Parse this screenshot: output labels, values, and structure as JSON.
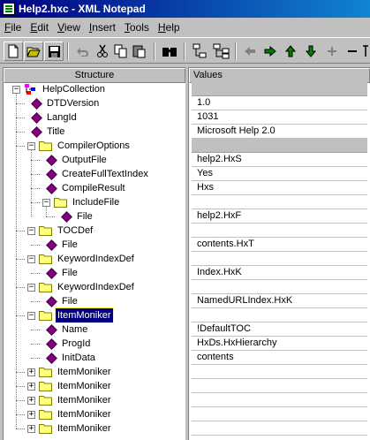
{
  "window": {
    "title": "Help2.hxc - XML Notepad"
  },
  "menu": [
    {
      "label": "File",
      "u": "F",
      "rest": "ile"
    },
    {
      "label": "Edit",
      "u": "E",
      "rest": "dit"
    },
    {
      "label": "View",
      "u": "V",
      "rest": "iew"
    },
    {
      "label": "Insert",
      "u": "I",
      "rest": "nsert"
    },
    {
      "label": "Tools",
      "u": "T",
      "rest": "ools"
    },
    {
      "label": "Help",
      "u": "H",
      "rest": "elp"
    }
  ],
  "columns": {
    "structure": "Structure",
    "values": "Values"
  },
  "tree": [
    {
      "label": "HelpCollection",
      "kind": "root",
      "depth": 0,
      "expanded": true,
      "value": null
    },
    {
      "label": "DTDVersion",
      "kind": "attr",
      "depth": 1,
      "value": "1.0"
    },
    {
      "label": "LangId",
      "kind": "attr",
      "depth": 1,
      "value": "1031"
    },
    {
      "label": "Title",
      "kind": "attr",
      "depth": 1,
      "value": "Microsoft Help 2.0"
    },
    {
      "label": "CompilerOptions",
      "kind": "folder",
      "depth": 1,
      "expanded": true,
      "value": null
    },
    {
      "label": "OutputFile",
      "kind": "attr",
      "depth": 2,
      "value": "help2.HxS"
    },
    {
      "label": "CreateFullTextIndex",
      "kind": "attr",
      "depth": 2,
      "value": "Yes"
    },
    {
      "label": "CompileResult",
      "kind": "attr",
      "depth": 2,
      "value": "Hxs"
    },
    {
      "label": "IncludeFile",
      "kind": "folder",
      "depth": 2,
      "expanded": true,
      "value": ""
    },
    {
      "label": "File",
      "kind": "attr",
      "depth": 3,
      "value": "help2.HxF"
    },
    {
      "label": "TOCDef",
      "kind": "folder",
      "depth": 1,
      "expanded": true,
      "value": ""
    },
    {
      "label": "File",
      "kind": "attr",
      "depth": 2,
      "value": "contents.HxT"
    },
    {
      "label": "KeywordIndexDef",
      "kind": "folder",
      "depth": 1,
      "expanded": true,
      "value": ""
    },
    {
      "label": "File",
      "kind": "attr",
      "depth": 2,
      "value": "Index.HxK"
    },
    {
      "label": "KeywordIndexDef",
      "kind": "folder",
      "depth": 1,
      "expanded": true,
      "value": ""
    },
    {
      "label": "File",
      "kind": "attr",
      "depth": 2,
      "value": "NamedURLIndex.HxK"
    },
    {
      "label": "ItemMoniker",
      "kind": "folder",
      "depth": 1,
      "expanded": true,
      "selected": true,
      "value": ""
    },
    {
      "label": "Name",
      "kind": "attr",
      "depth": 2,
      "value": "!DefaultTOC"
    },
    {
      "label": "ProgId",
      "kind": "attr",
      "depth": 2,
      "value": "HxDs.HxHierarchy"
    },
    {
      "label": "InitData",
      "kind": "attr",
      "depth": 2,
      "value": "contents"
    },
    {
      "label": "ItemMoniker",
      "kind": "folder",
      "depth": 1,
      "expanded": false,
      "value": ""
    },
    {
      "label": "ItemMoniker",
      "kind": "folder",
      "depth": 1,
      "expanded": false,
      "value": ""
    },
    {
      "label": "ItemMoniker",
      "kind": "folder",
      "depth": 1,
      "expanded": false,
      "value": ""
    },
    {
      "label": "ItemMoniker",
      "kind": "folder",
      "depth": 1,
      "expanded": false,
      "value": ""
    },
    {
      "label": "ItemMoniker",
      "kind": "folder",
      "depth": 1,
      "expanded": false,
      "value": ""
    }
  ],
  "toolbar_icons": [
    "new-icon",
    "open-icon",
    "save-icon",
    "undo-icon",
    "cut-icon",
    "copy-icon",
    "paste-icon",
    "find-icon",
    "insert-node-icon",
    "insert-child-icon",
    "back-icon",
    "forward-icon",
    "up-icon",
    "down-icon",
    "add-icon",
    "remove-icon",
    "more-icon"
  ],
  "colors": {
    "titlebar": "#000080",
    "selection": "#000080",
    "diamond": "#800080",
    "folder": "#ffff80"
  }
}
